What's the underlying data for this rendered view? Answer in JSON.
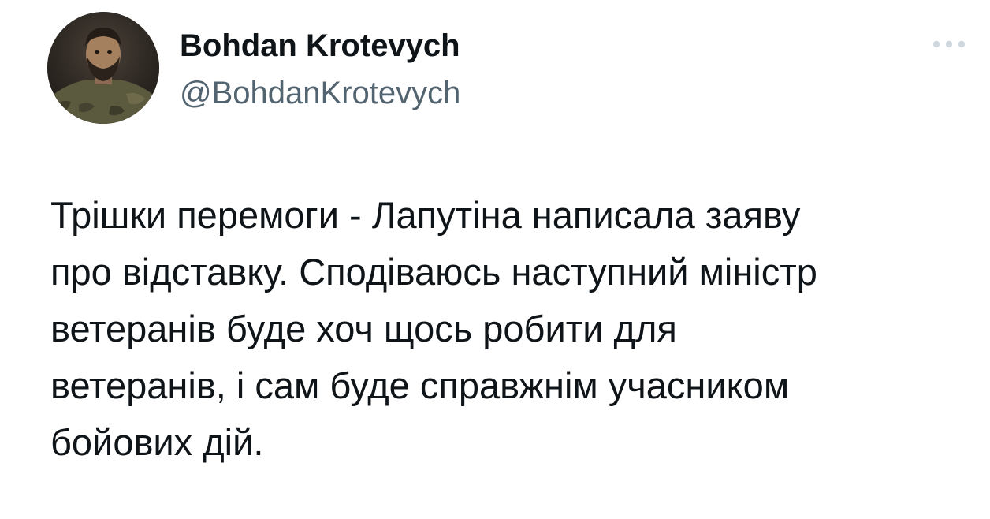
{
  "author": {
    "display_name": "Bohdan Krotevych",
    "handle": "@BohdanKrotevych",
    "avatar_icon": "profile-photo"
  },
  "more_button_icon": "ellipsis-icon",
  "tweet": {
    "text": "Трішки перемоги - Лапутіна написала заяву\nпро відставку. Сподіваюсь наступний міністр\nветеранів буде хоч щось робити для\nветеранів, і сам буде справжнім учасником\nбойових дій."
  },
  "colors": {
    "text_primary": "#0f1419",
    "text_secondary": "#536471",
    "icon_muted": "#cfd9de"
  }
}
